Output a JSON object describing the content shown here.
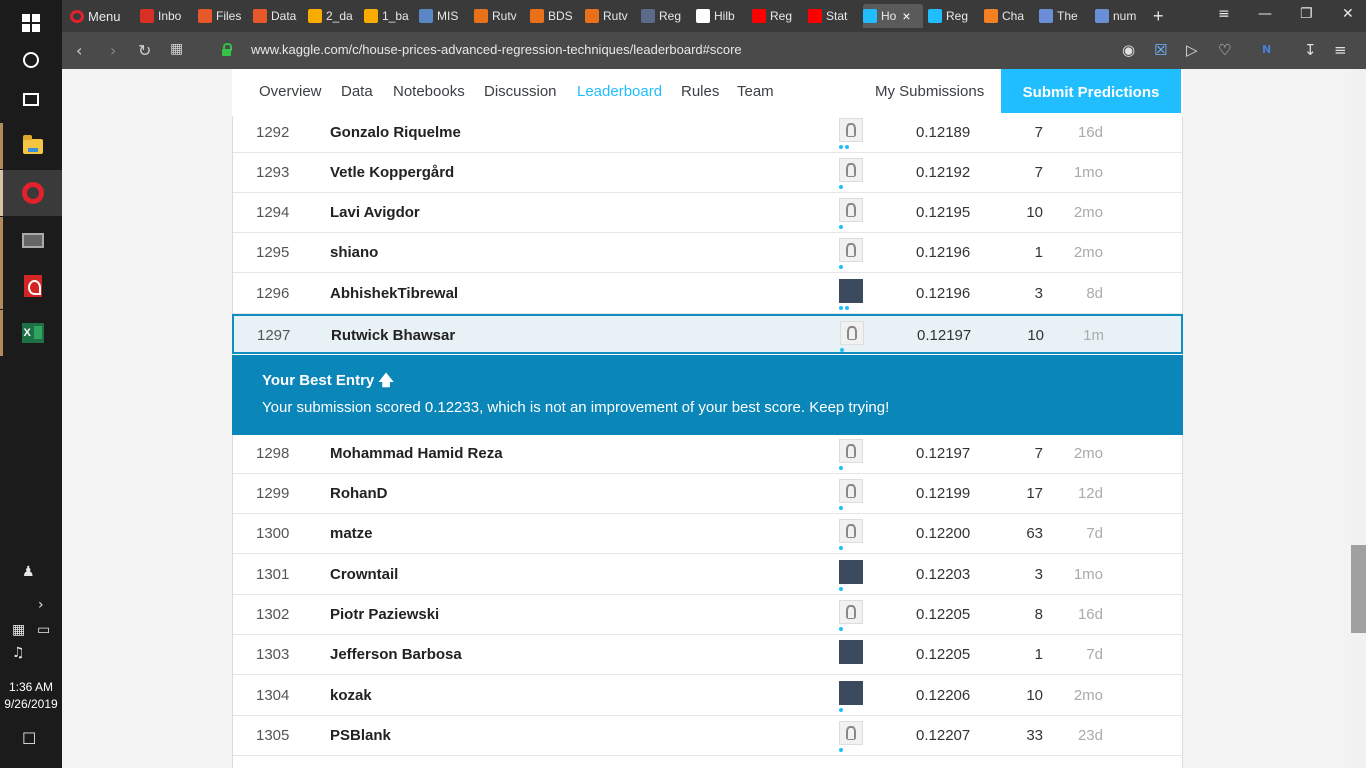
{
  "taskbar": {
    "clock_time": "1:36 AM",
    "clock_date": "9/26/2019"
  },
  "browser": {
    "menu_label": "Menu",
    "tabs": [
      {
        "label": "Inbo",
        "icon": "gmail-icon",
        "color": "#d93025"
      },
      {
        "label": "Files",
        "icon": "drive-icon",
        "color": "#e8572a"
      },
      {
        "label": "Data",
        "icon": "drive-icon",
        "color": "#e8572a"
      },
      {
        "label": "2_da",
        "icon": "colab-icon",
        "color": "#f9ab00"
      },
      {
        "label": "1_ba",
        "icon": "colab-icon",
        "color": "#f9ab00"
      },
      {
        "label": "MIS",
        "icon": "p-icon",
        "color": "#5b86c5"
      },
      {
        "label": "Rutv",
        "icon": "book-icon",
        "color": "#e8711a"
      },
      {
        "label": "BDS",
        "icon": "book-icon",
        "color": "#e8711a"
      },
      {
        "label": "Rutv",
        "icon": "book-icon",
        "color": "#e8711a"
      },
      {
        "label": "Reg",
        "icon": "page-icon",
        "color": "#5c6b8a"
      },
      {
        "label": "Hilb",
        "icon": "wikipedia-icon",
        "color": "#ffffff"
      },
      {
        "label": "Reg",
        "icon": "youtube-icon",
        "color": "#ff0000"
      },
      {
        "label": "Stat",
        "icon": "youtube-icon",
        "color": "#ff0000"
      },
      {
        "label": "Ho",
        "icon": "kaggle-icon",
        "color": "#20beff",
        "active": true
      },
      {
        "label": "Reg",
        "icon": "kaggle-icon",
        "color": "#20beff"
      },
      {
        "label": "Cha",
        "icon": "stackoverflow-icon",
        "color": "#f48024"
      },
      {
        "label": "The",
        "icon": "s-icon",
        "color": "#6b8fd6"
      },
      {
        "label": "num",
        "icon": "s-icon",
        "color": "#6b8fd6"
      }
    ],
    "url": "www.kaggle.com/c/house-prices-advanced-regression-techniques/leaderboard#score"
  },
  "competition_nav": {
    "tabs": [
      "Overview",
      "Data",
      "Notebooks",
      "Discussion",
      "Leaderboard",
      "Rules",
      "Team"
    ],
    "active_tab": "Leaderboard",
    "my_submissions": "My Submissions",
    "submit_button": "Submit Predictions",
    "accent": "#20beff"
  },
  "best_entry": {
    "title": "Your Best Entry",
    "message": "Your submission scored 0.12233, which is not an improvement of your best score. Keep trying!",
    "bg": "#0a86b8"
  },
  "leaderboard": {
    "rows": [
      {
        "rank": "1292",
        "name": "Gonzalo Riquelme",
        "score": "0.12189",
        "entries": "7",
        "last": "16d",
        "avatar": "default",
        "dots": 2
      },
      {
        "rank": "1293",
        "name": "Vetle Koppergård",
        "score": "0.12192",
        "entries": "7",
        "last": "1mo",
        "avatar": "default",
        "dots": 1
      },
      {
        "rank": "1294",
        "name": "Lavi Avigdor",
        "score": "0.12195",
        "entries": "10",
        "last": "2mo",
        "avatar": "default",
        "dots": 1
      },
      {
        "rank": "1295",
        "name": "shiano",
        "score": "0.12196",
        "entries": "1",
        "last": "2mo",
        "avatar": "default",
        "dots": 1
      },
      {
        "rank": "1296",
        "name": "AbhishekTibrewal",
        "score": "0.12196",
        "entries": "3",
        "last": "8d",
        "avatar": "photo",
        "dots": 2
      },
      {
        "rank": "1297",
        "name": "Rutwick Bhawsar",
        "score": "0.12197",
        "entries": "10",
        "last": "1m",
        "avatar": "default",
        "dots": 1,
        "mine": true
      },
      {
        "rank": "1298",
        "name": "Mohammad Hamid Reza",
        "score": "0.12197",
        "entries": "7",
        "last": "2mo",
        "avatar": "default",
        "dots": 1
      },
      {
        "rank": "1299",
        "name": "RohanD",
        "score": "0.12199",
        "entries": "17",
        "last": "12d",
        "avatar": "default",
        "dots": 1
      },
      {
        "rank": "1300",
        "name": "matze",
        "score": "0.12200",
        "entries": "63",
        "last": "7d",
        "avatar": "default",
        "dots": 1
      },
      {
        "rank": "1301",
        "name": "Crowntail",
        "score": "0.12203",
        "entries": "3",
        "last": "1mo",
        "avatar": "photo",
        "dots": 1
      },
      {
        "rank": "1302",
        "name": "Piotr Paziewski",
        "score": "0.12205",
        "entries": "8",
        "last": "16d",
        "avatar": "default",
        "dots": 1
      },
      {
        "rank": "1303",
        "name": "Jefferson Barbosa",
        "score": "0.12205",
        "entries": "1",
        "last": "7d",
        "avatar": "photo",
        "dots": 0
      },
      {
        "rank": "1304",
        "name": "kozak",
        "score": "0.12206",
        "entries": "10",
        "last": "2mo",
        "avatar": "photo",
        "dots": 1
      },
      {
        "rank": "1305",
        "name": "PSBlank",
        "score": "0.12207",
        "entries": "33",
        "last": "23d",
        "avatar": "default",
        "dots": 1
      }
    ]
  }
}
